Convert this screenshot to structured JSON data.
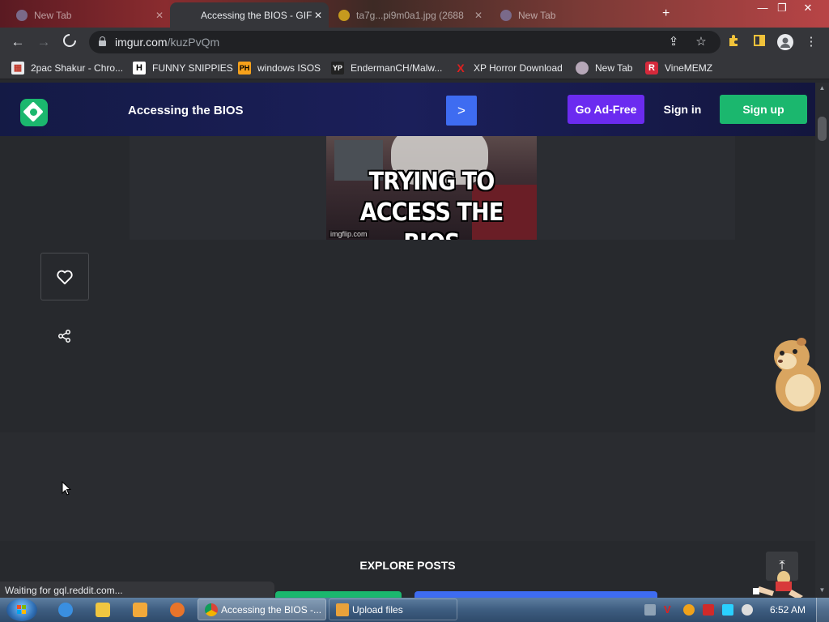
{
  "browser": {
    "tabs": [
      {
        "title": "New Tab",
        "active": false
      },
      {
        "title": "Accessing the BIOS - GIF",
        "active": true
      },
      {
        "title": "ta7g...pi9m0a1.jpg (2688",
        "active": false
      },
      {
        "title": "New Tab",
        "active": false
      }
    ],
    "new_tab_icon": "plus-icon",
    "window_controls": [
      "minimize-icon",
      "maximize-icon",
      "close-icon"
    ],
    "url_host": "imgur.com",
    "url_path": "/kuzPvQm",
    "bookmarks": [
      {
        "label": "2pac Shakur - Chro...",
        "icon": "app-icon"
      },
      {
        "label": "FUNNY SNIPPIES",
        "icon": "H"
      },
      {
        "label": "windows ISOS",
        "icon": "PH"
      },
      {
        "label": "EndermanCH/Malw...",
        "icon": "YP"
      },
      {
        "label": "XP Horror Download",
        "icon": "X"
      },
      {
        "label": "New Tab",
        "icon": "globe-icon"
      },
      {
        "label": "VineMEMZ",
        "icon": "R"
      }
    ],
    "status_text": "Waiting for gql.reddit.com..."
  },
  "imgur": {
    "post_title": "Accessing the BIOS",
    "next_label": ">",
    "go_ad_free": "Go Ad-Free",
    "sign_in": "Sign in",
    "sign_up": "Sign up",
    "gif_caption_line1": "TRYING TO",
    "gif_caption_line2": "ACCESS THE BIOS",
    "gif_watermark": "imgflip.com",
    "explore_label": "EXPLORE POSTS",
    "colors": {
      "header": "#1b1f5a",
      "green": "#1bb76e",
      "blue": "#3e6cf1",
      "purple": "#6b2bf0",
      "page_bg": "#27292d"
    }
  },
  "taskbar": {
    "tasks": [
      {
        "label": "Accessing the BIOS -...",
        "active": true
      },
      {
        "label": "Upload files",
        "active": false
      }
    ],
    "clock": "6:52 AM"
  }
}
